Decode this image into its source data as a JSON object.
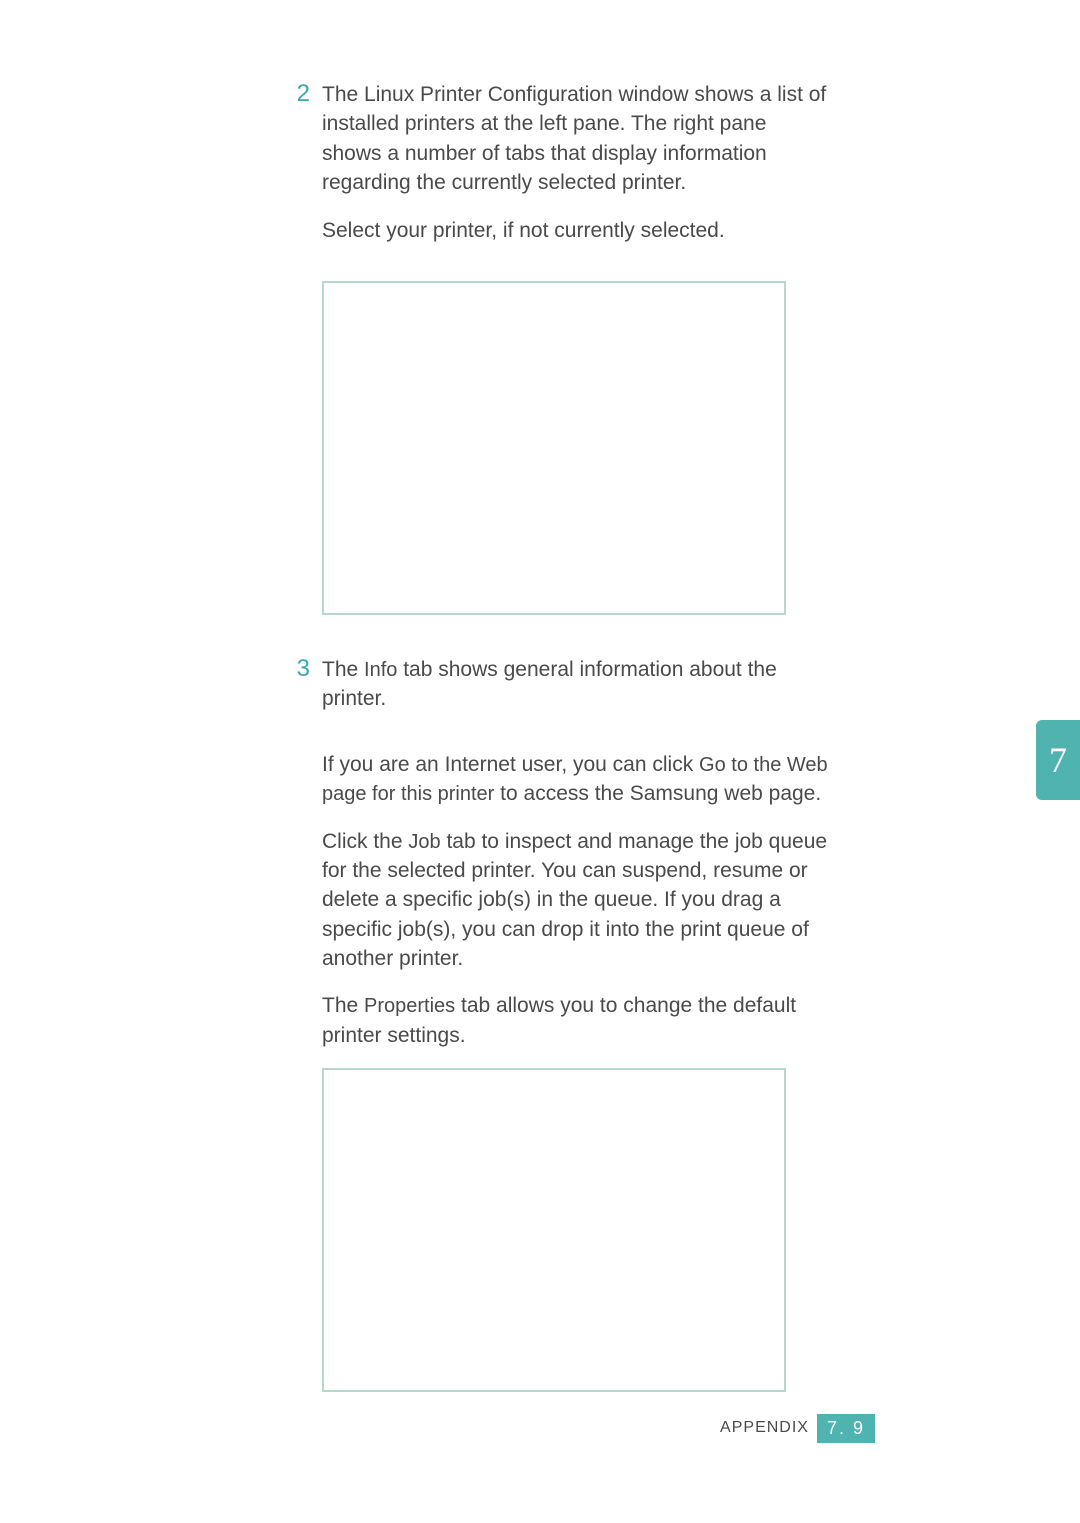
{
  "steps": {
    "s2": {
      "num": "2",
      "p1": "The Linux Printer Configuration window shows a list of installed printers at the left pane. The right pane shows a number of tabs that display information regarding the currently selected printer.",
      "p2": "Select your printer, if not currently selected."
    },
    "s3": {
      "num": "3",
      "p1a": "The ",
      "p1_tab": "Info",
      "p1b": " tab shows general information about the printer.",
      "p2a": "If you are an Internet user, you can click ",
      "p2_link": "Go to the Web page for this printer",
      "p2b": " to access the Samsung web page.",
      "p3a": "Click the ",
      "p3_tab": "Job",
      "p3b": " tab to inspect and manage the job queue for the selected printer. You can suspend, resume or delete a specific job(s) in the queue. If you drag a specific job(s), you can drop it into the print queue of another printer.",
      "p4a": "The ",
      "p4_tab": "Properties",
      "p4b": " tab allows you to change the default printer settings."
    }
  },
  "sideTab": "7",
  "footer": {
    "label": "APPENDIX",
    "page": "7. 9"
  }
}
